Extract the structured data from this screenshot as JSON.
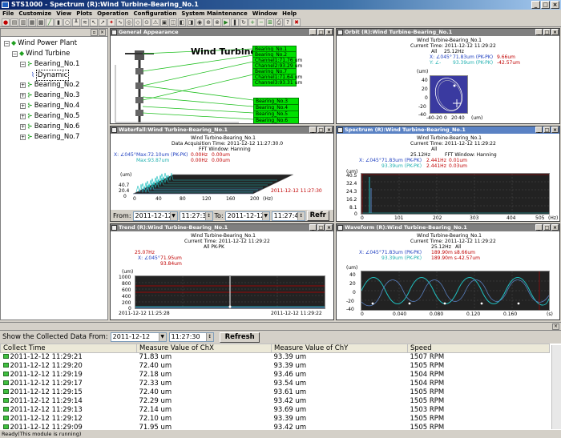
{
  "window": {
    "title": "STS1000 - Spectrum (R):Wind Turbine-Bearing_No.1"
  },
  "menu": [
    "File",
    "Customize",
    "View",
    "Plots",
    "Operation",
    "Configuration",
    "System Maintenance",
    "Window",
    "Help"
  ],
  "tree": {
    "root": "Wind Power Plant",
    "turbine": "Wind Turbine",
    "items": [
      "Bearing_No.1",
      "Dynamic",
      "Bearing_No.2",
      "Bearing_No.3",
      "Bearing_No.4",
      "Bearing_No.5",
      "Bearing_No.6",
      "Bearing_No.7"
    ]
  },
  "general": {
    "title": "General Appearance",
    "heading": "Wind Turbine",
    "boxes": [
      "Bearing_No.1",
      "Bearing_No.2",
      "Channel1:71.76 um",
      "Channel2:93.29 um",
      "Bearing_No.7",
      "Channel1:71.64 um",
      "Channel3:93.31 um",
      "Bearing_No.3",
      "Bearing_No.4",
      "Bearing_No.5",
      "Bearing_No.6"
    ]
  },
  "orbit": {
    "title": "Orbit (R):Wind Turbine-Bearing_No.1",
    "name": "Wind Turbine-Bearing_No.1",
    "time": "Current Time: 2011-12-12 11:29:22",
    "mode": "All",
    "freq": "25.12Hz",
    "x": "X: ∠045°",
    "xv": "71.83um (PK-PK)",
    "xa": "9.66um",
    "y": "Y: ∠-",
    "yv": "93.39um (PK-PK)",
    "ya": "-42.57um",
    "ylabel": "(um)",
    "xlabel": "(um)",
    "yticks": [
      "40",
      "20",
      "0",
      "-20",
      "-40"
    ],
    "xticks": [
      "-40",
      "-20",
      "0",
      "20",
      "40"
    ]
  },
  "waterfall": {
    "title": "Waterfall:Wind Turbine-Bearing_No.1",
    "name": "Wind Turbine-Bearing_No.1",
    "time": "Data Acquisition Time: 2011-12-12 11:27:30.0",
    "window": "FFT Window: Hanning",
    "x": "X: ∠045°",
    "xv": "Max:72.10um (PK-PK)",
    "xa": "0.00Hz",
    "xb": "0.00um",
    "yv": "Max:93.87um",
    "ya": "0.00Hz",
    "yb": "0.00um",
    "ylabel": "(um)",
    "yticks": [
      "40.7",
      "20.4",
      "0"
    ],
    "xticks": [
      "0",
      "40",
      "80",
      "120",
      "160",
      "200"
    ],
    "xunit": "(Hz)",
    "stamp": "2011-12-12 11:27:30",
    "from_label": "From:",
    "from_date": "2011-12-12",
    "from_time": "11:27:30",
    "to_label": "To:",
    "to_date": "2011-12-12",
    "to_time": "11:27:49",
    "refresh": "Refr"
  },
  "spectrum": {
    "title": "Spectrum (R):Wind Turbine-Bearing_No.1",
    "name": "Wind Turbine-Bearing_No.1",
    "time": "Current Time: 2011-12-12 11:29:22",
    "freq": "25.12Hz",
    "window": "FFT Window: Hanning",
    "mode": "All",
    "x": "X: ∠045°",
    "xv": "71.83um (PK-PK)",
    "xa": "2.441Hz",
    "xb": "0.01um",
    "yv": "93.39um (PK-PK)",
    "ya": "2.441Hz",
    "yb": "0.03um",
    "ylabel": "(um)",
    "yticks": [
      "40.5",
      "32.4",
      "24.3",
      "16.2",
      "8.1",
      "0"
    ],
    "xticks": [
      "0",
      "101",
      "202",
      "303",
      "404",
      "505"
    ],
    "xunit": "(Hz)"
  },
  "trend": {
    "title": "Trend (R):Wind Turbine-Bearing_No.1",
    "name": "Wind Turbine-Bearing_No.1",
    "time": "Current Time: 2011-12-12 11:29:22",
    "mode": "All   PK-PK",
    "freq": "25.07Hz",
    "x": "X: ∠045°",
    "xv": "71.95um",
    "yv": "93.84um",
    "ylabel": "(um)",
    "yticks": [
      "1000",
      "800",
      "600",
      "400",
      "200",
      "0"
    ],
    "start": "2011-12-12 11:25:28",
    "end": "2011-12-12 11:29:22"
  },
  "waveform": {
    "title": "Waveform (R):Wind Turbine-Bearing_No.1",
    "name": "Wind Turbine-Bearing_No.1",
    "time": "Current Time: 2011-12-12 11:29:22",
    "freq": "25.12Hz",
    "mode": "All",
    "x": "X: ∠045°",
    "xv": "71.83um (PK-PK)",
    "xa": "189.90m s",
    "xb": "8.66um",
    "yv": "93.39um (PK-PK)",
    "ya": "189.90m s",
    "yb": "-42.57um",
    "ylabel": "(um)",
    "yticks": [
      "40",
      "20",
      "0",
      "-20",
      "-40"
    ],
    "xticks": [
      "0",
      "0.040",
      "0.080",
      "0.120",
      "0.160"
    ],
    "xunit": "(s)"
  },
  "history": {
    "label": "Show the Collected Data From:",
    "date": "2011-12-12",
    "time": "11:27:30",
    "refresh": "Refresh",
    "columns": [
      "Collect Time",
      "Measure Value of ChX",
      "Measure Value of ChY",
      "Speed"
    ],
    "rows": [
      [
        "2011-12-12 11:29:21",
        "71.83 um",
        "93.39 um",
        "1507 RPM"
      ],
      [
        "2011-12-12 11:29:20",
        "72.40 um",
        "93.39 um",
        "1505 RPM"
      ],
      [
        "2011-12-12 11:29:19",
        "72.18 um",
        "93.46 um",
        "1504 RPM"
      ],
      [
        "2011-12-12 11:29:17",
        "72.33 um",
        "93.54 um",
        "1504 RPM"
      ],
      [
        "2011-12-12 11:29:15",
        "72.40 um",
        "93.61 um",
        "1505 RPM"
      ],
      [
        "2011-12-12 11:29:14",
        "72.29 um",
        "93.42 um",
        "1505 RPM"
      ],
      [
        "2011-12-12 11:29:13",
        "72.14 um",
        "93.69 um",
        "1503 RPM"
      ],
      [
        "2011-12-12 11:29:12",
        "72.10 um",
        "93.39 um",
        "1505 RPM"
      ],
      [
        "2011-12-12 11:29:09",
        "71.95 um",
        "93.42 um",
        "1505 RPM"
      ]
    ]
  },
  "status": "Ready(This module is running)"
}
